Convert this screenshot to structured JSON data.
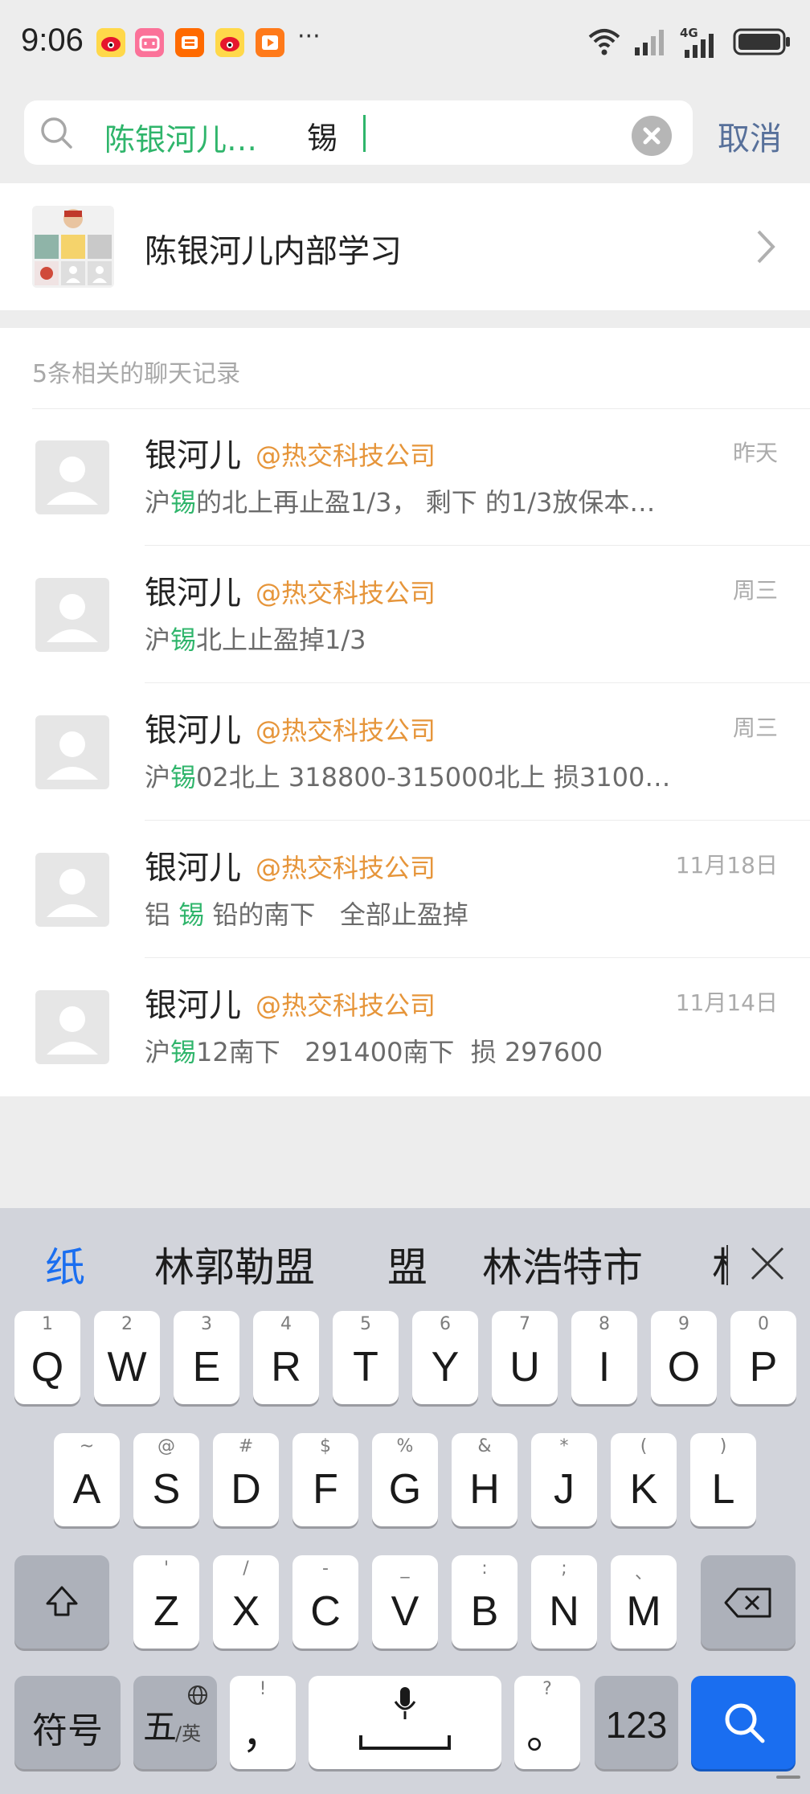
{
  "status": {
    "time": "9:06",
    "more": "···",
    "network": "4G",
    "app_icons": [
      "weibo-icon",
      "bilibili-icon",
      "xianyu-icon",
      "weibo-icon",
      "app-icon"
    ]
  },
  "search": {
    "scope_tag": "陈银河儿…",
    "query": "锡",
    "cancel_label": "取消"
  },
  "group": {
    "name": "陈银河儿内部学习"
  },
  "results": {
    "header": "5条相关的聊天记录",
    "items": [
      {
        "name": "银河儿",
        "org": "@热交科技公司",
        "date": "昨天",
        "pre": "沪",
        "hit": "锡",
        "post": "的北上再止盈1/3， 剩下 的1/3放保本…"
      },
      {
        "name": "银河儿",
        "org": "@热交科技公司",
        "date": "周三",
        "pre": "沪",
        "hit": "锡",
        "post": "北上止盈掉1/3"
      },
      {
        "name": "银河儿",
        "org": "@热交科技公司",
        "date": "周三",
        "pre": "沪",
        "hit": "锡",
        "post": "02北上  318800-315000北上  损3100…"
      },
      {
        "name": "银河儿",
        "org": "@热交科技公司",
        "date": "11月18日",
        "pre": "铝 ",
        "hit": "锡",
        "post": " 铅的南下   全部止盈掉"
      },
      {
        "name": "银河儿",
        "org": "@热交科技公司",
        "date": "11月14日",
        "pre": "沪",
        "hit": "锡",
        "post": "12南下   291400南下  损 297600"
      }
    ]
  },
  "keyboard": {
    "candidates": [
      "纸",
      "林郭勒盟",
      "盟",
      "林浩特市",
      "林"
    ],
    "row1": [
      [
        "1",
        "Q"
      ],
      [
        "2",
        "W"
      ],
      [
        "3",
        "E"
      ],
      [
        "4",
        "R"
      ],
      [
        "5",
        "T"
      ],
      [
        "6",
        "Y"
      ],
      [
        "7",
        "U"
      ],
      [
        "8",
        "I"
      ],
      [
        "9",
        "O"
      ],
      [
        "0",
        "P"
      ]
    ],
    "row2": [
      [
        "~",
        "A"
      ],
      [
        "@",
        "S"
      ],
      [
        "#",
        "D"
      ],
      [
        "$",
        "F"
      ],
      [
        "%",
        "G"
      ],
      [
        "&",
        "H"
      ],
      [
        "*",
        "J"
      ],
      [
        "(",
        "K"
      ],
      [
        ")",
        "L"
      ]
    ],
    "row3": [
      [
        "'",
        "Z"
      ],
      [
        "/",
        "X"
      ],
      [
        "-",
        "C"
      ],
      [
        "_",
        "V"
      ],
      [
        ":",
        "B"
      ],
      [
        ";",
        "N"
      ],
      [
        "、",
        "M"
      ]
    ],
    "symbols_label": "符号",
    "lang_main": "五",
    "lang_sub": "/英",
    "comma_hint": "!",
    "comma": "，",
    "period_hint": "?",
    "period": "。",
    "num_label": "123"
  }
}
